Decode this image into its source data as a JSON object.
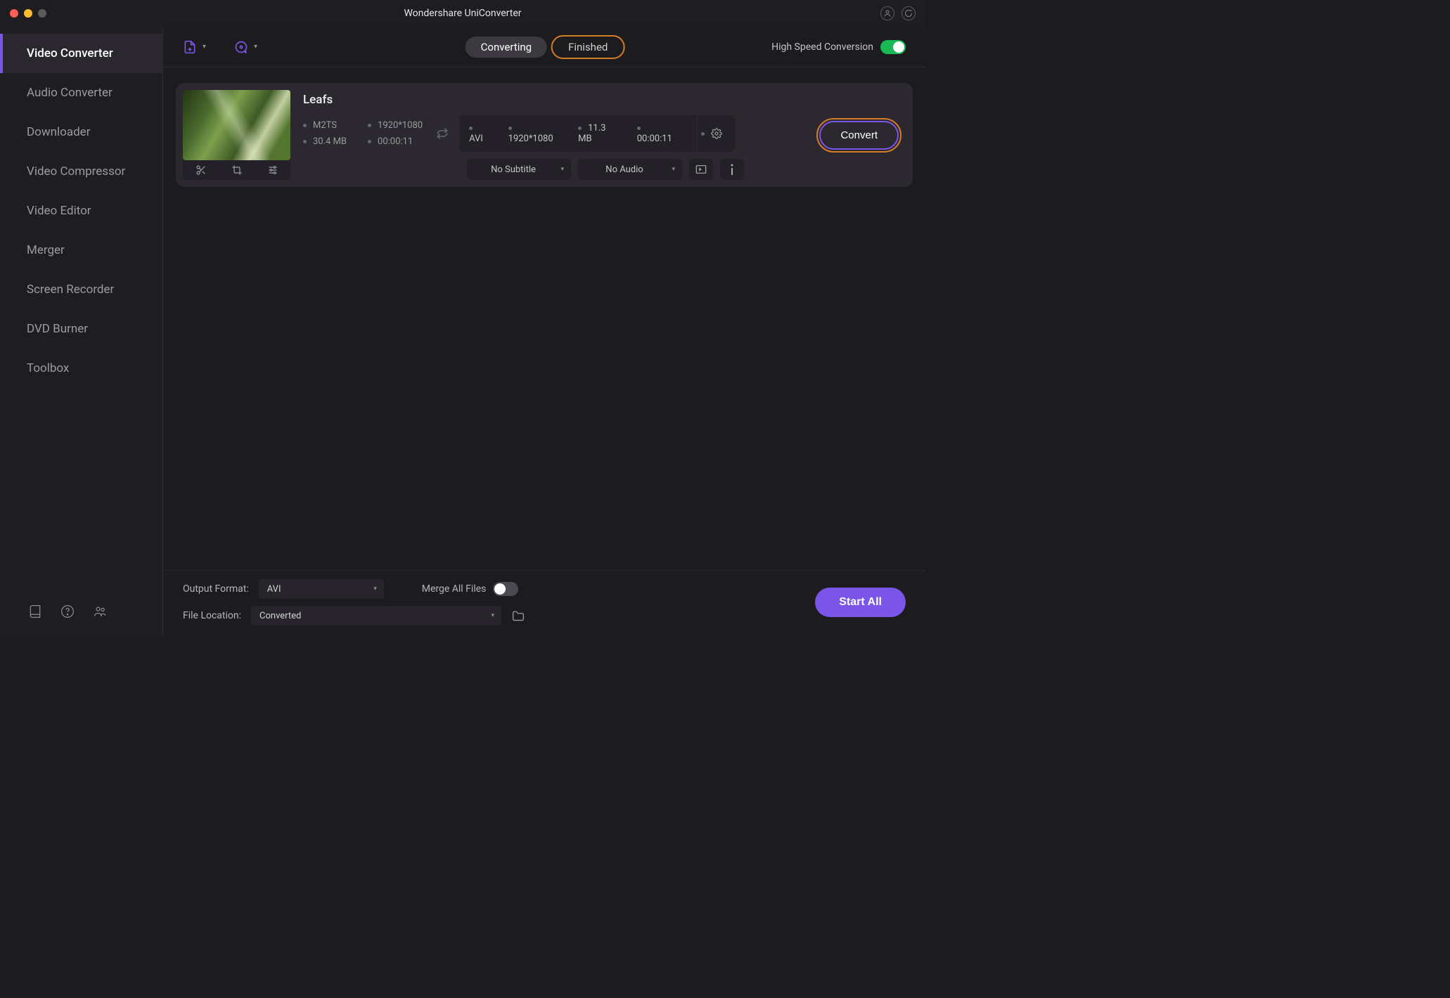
{
  "app_title": "Wondershare UniConverter",
  "sidebar": {
    "items": [
      {
        "label": "Video Converter",
        "active": true
      },
      {
        "label": "Audio Converter"
      },
      {
        "label": "Downloader"
      },
      {
        "label": "Video Compressor"
      },
      {
        "label": "Video Editor"
      },
      {
        "label": "Merger"
      },
      {
        "label": "Screen Recorder"
      },
      {
        "label": "DVD Burner"
      },
      {
        "label": "Toolbox"
      }
    ]
  },
  "toolbar": {
    "tabs": {
      "converting": "Converting",
      "finished": "Finished"
    },
    "high_speed_label": "High Speed Conversion"
  },
  "job": {
    "name": "Leafs",
    "source": {
      "format": "M2TS",
      "resolution": "1920*1080",
      "size": "30.4 MB",
      "duration": "00:00:11"
    },
    "output": {
      "format": "AVI",
      "resolution": "1920*1080",
      "size": "11.3 MB",
      "duration": "00:00:11"
    },
    "subtitle_label": "No Subtitle",
    "audio_label": "No Audio",
    "convert_label": "Convert"
  },
  "footer": {
    "output_format_label": "Output Format:",
    "output_format_value": "AVI",
    "file_location_label": "File Location:",
    "file_location_value": "Converted",
    "merge_label": "Merge All Files",
    "start_all_label": "Start All"
  }
}
